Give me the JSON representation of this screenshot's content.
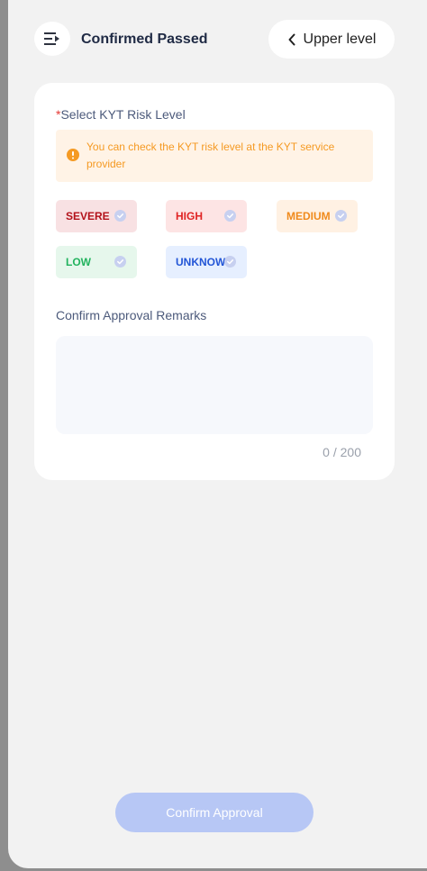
{
  "header": {
    "title": "Confirmed Passed",
    "back_label": "Upper level",
    "menu_icon": "collapse-menu-icon"
  },
  "risk": {
    "required_mark": "*",
    "label": "Select KYT Risk Level",
    "notice": "You can check the KYT risk level at the KYT service provider",
    "levels": [
      {
        "label": "SEVERE",
        "text_color": "#b3121b",
        "bg": "#f8e1e3"
      },
      {
        "label": "HIGH",
        "text_color": "#e02424",
        "bg": "#fde4e4"
      },
      {
        "label": "MEDIUM",
        "text_color": "#f08a1c",
        "bg": "#fff1e3"
      },
      {
        "label": "LOW",
        "text_color": "#22b35e",
        "bg": "#e6f7ec"
      },
      {
        "label": "UNKNOW",
        "text_color": "#2255d6",
        "bg": "#e6efff"
      }
    ]
  },
  "remarks": {
    "label": "Confirm Approval Remarks",
    "value": "",
    "counter": "0 / 200"
  },
  "footer": {
    "confirm_label": "Confirm Approval"
  },
  "colors": {
    "accent_disabled": "#b7c7f5",
    "warning": "#f59a23"
  }
}
